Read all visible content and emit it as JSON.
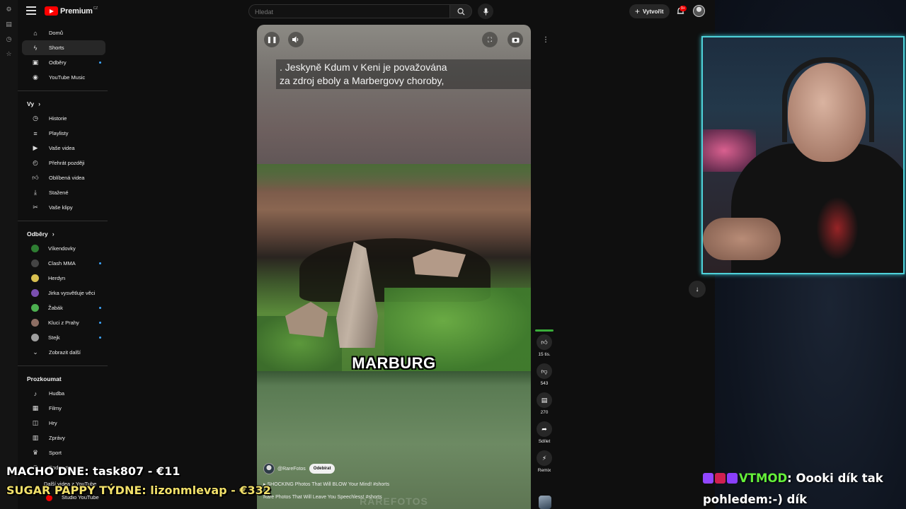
{
  "youtube": {
    "logo_text": "Premium",
    "logo_region": "CZ",
    "search_placeholder": "Hledat",
    "create_label": "Vytvořit",
    "notif_badge": "9+"
  },
  "sidebar": {
    "main": [
      {
        "label": "Domů",
        "icon": "home-icon",
        "active": false,
        "dot": false
      },
      {
        "label": "Shorts",
        "icon": "shorts-icon",
        "active": true,
        "dot": false
      },
      {
        "label": "Odběry",
        "icon": "subscriptions-icon",
        "active": false,
        "dot": true
      },
      {
        "label": "YouTube Music",
        "icon": "music-icon",
        "active": false,
        "dot": false
      }
    ],
    "you_heading": "Vy",
    "you": [
      {
        "label": "Historie",
        "icon": "history-icon"
      },
      {
        "label": "Playlisty",
        "icon": "playlist-icon"
      },
      {
        "label": "Vaše videa",
        "icon": "video-icon"
      },
      {
        "label": "Přehrát později",
        "icon": "clock-icon"
      },
      {
        "label": "Oblíbená videa",
        "icon": "like-icon"
      },
      {
        "label": "Stažené",
        "icon": "download-icon"
      },
      {
        "label": "Vaše klipy",
        "icon": "scissors-icon"
      }
    ],
    "subs_heading": "Odběry",
    "subs": [
      {
        "label": "Víkendovky",
        "color": "#2e7d32",
        "dot": false
      },
      {
        "label": "Clash MMA",
        "color": "#444444",
        "dot": true
      },
      {
        "label": "Herdyn",
        "color": "#d8c050",
        "dot": false
      },
      {
        "label": "Jirka vysvětluje věci",
        "color": "#7a4fb0",
        "dot": false
      },
      {
        "label": "Žabák",
        "color": "#4caf50",
        "dot": true
      },
      {
        "label": "Kluci z Prahy",
        "color": "#8d6e63",
        "dot": true
      },
      {
        "label": "Stejk",
        "color": "#9e9e9e",
        "dot": true
      }
    ],
    "show_more": "Zobrazit další",
    "explore_heading": "Prozkoumat",
    "explore": [
      {
        "label": "Hudba",
        "icon": "music-note-icon"
      },
      {
        "label": "Filmy",
        "icon": "film-icon"
      },
      {
        "label": "Hry",
        "icon": "gamepad-icon"
      },
      {
        "label": "Zprávy",
        "icon": "news-icon"
      },
      {
        "label": "Sport",
        "icon": "trophy-icon"
      },
      {
        "label": "Podcasty",
        "icon": "podcast-icon"
      }
    ],
    "more_heading": "Další videa z YouTube",
    "studio": "Studio YouTube"
  },
  "short": {
    "caption_line1": ".  Jeskyně Kdum v Keni je považována",
    "caption_line2": "za zdroj eboly a Marbergovy choroby,",
    "overlay_word": "MARBURG",
    "channel": "@RareFotos",
    "subscribe": "Odebírat",
    "title": "SHOCKING Photos That Will BLOW Your Mind! #shorts",
    "next_title": "Rare Photos That Will Leave You Speechless! #shorts",
    "watermark": "RAREFOTOS"
  },
  "actions": {
    "likes": "15 tis.",
    "dislikes": "543",
    "comments": "270",
    "share": "Sdílet",
    "remix": "Remix"
  },
  "stream": {
    "overlay1": "MACHO DNE: task807 - €11",
    "overlay2": "SUGAR PAPPY TÝDNE: lizonmlevap - €332",
    "chat_user": "VTMOD",
    "chat_message": ": Oooki dík tak pohledem:-) dík"
  }
}
